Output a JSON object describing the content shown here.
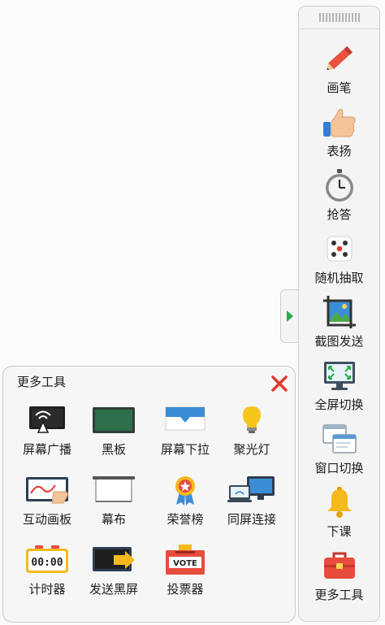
{
  "toolbar": {
    "items": [
      {
        "label": "画笔",
        "icon": "pen-icon"
      },
      {
        "label": "表扬",
        "icon": "thumbs-up-icon"
      },
      {
        "label": "抢答",
        "icon": "stopwatch-icon"
      },
      {
        "label": "随机抽取",
        "icon": "dice-icon"
      },
      {
        "label": "截图发送",
        "icon": "screenshot-icon"
      },
      {
        "label": "全屏切换",
        "icon": "fullscreen-icon"
      },
      {
        "label": "窗口切换",
        "icon": "windows-icon"
      },
      {
        "label": "下课",
        "icon": "bell-icon"
      },
      {
        "label": "更多工具",
        "icon": "toolbox-icon"
      }
    ]
  },
  "panel": {
    "title": "更多工具",
    "items": [
      {
        "label": "屏幕广播",
        "icon": "screen-broadcast-icon"
      },
      {
        "label": "黑板",
        "icon": "blackboard-icon"
      },
      {
        "label": "屏幕下拉",
        "icon": "screen-pulldown-icon"
      },
      {
        "label": "聚光灯",
        "icon": "spotlight-icon"
      },
      {
        "label": "互动画板",
        "icon": "interactive-board-icon"
      },
      {
        "label": "幕布",
        "icon": "curtain-icon"
      },
      {
        "label": "荣誉榜",
        "icon": "honor-badge-icon"
      },
      {
        "label": "同屏连接",
        "icon": "screen-connect-icon"
      },
      {
        "label": "计时器",
        "icon": "timer-icon"
      },
      {
        "label": "发送黑屏",
        "icon": "send-black-screen-icon"
      },
      {
        "label": "投票器",
        "icon": "vote-icon"
      }
    ],
    "timer_text": "00:00",
    "vote_text": "VOTE"
  },
  "colors": {
    "toolbar_bg": "#f4f4f4",
    "panel_bg": "#f6f6f6",
    "close_red": "#e03a2e",
    "collapse_arrow": "#2aa84a"
  }
}
